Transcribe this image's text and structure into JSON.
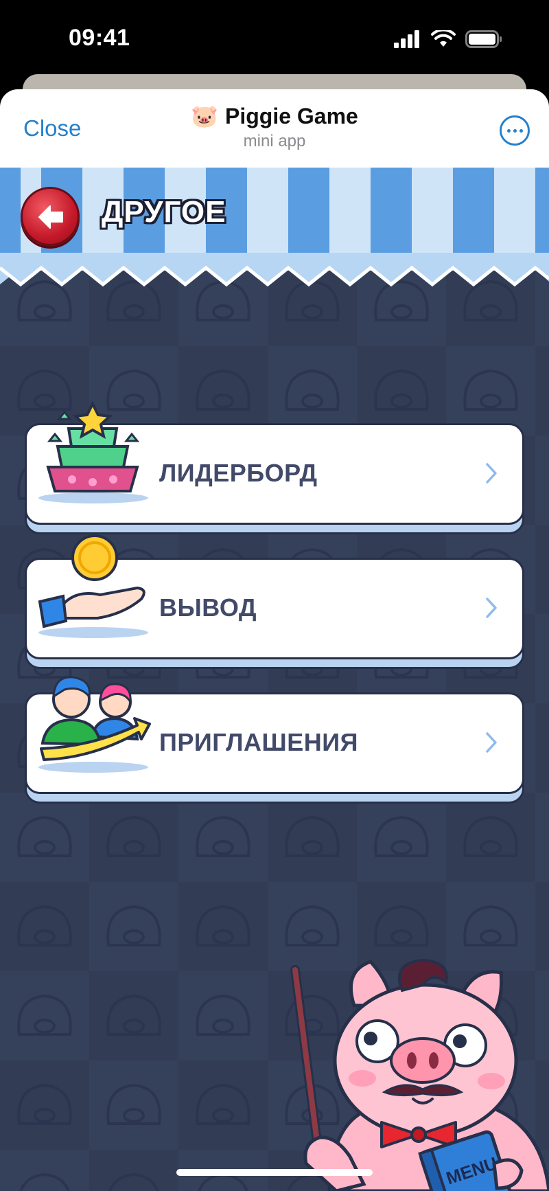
{
  "status_bar": {
    "time": "09:41"
  },
  "header": {
    "close_label": "Close",
    "app_emoji": "🐷",
    "title": "Piggie Game",
    "subtitle": "mini app",
    "more_icon": "ellipsis-circle-icon"
  },
  "screen": {
    "heading": "ДРУГОЕ",
    "back_icon": "arrow-left-icon"
  },
  "menu": [
    {
      "label": "ЛИДЕРБОРД",
      "icon": "trophy-podium-icon"
    },
    {
      "label": "ВЫВОД",
      "icon": "coin-hand-icon"
    },
    {
      "label": "ПРИГЛАШЕНИЯ",
      "icon": "friends-invite-icon"
    }
  ],
  "mascot": {
    "book_text": "MENU"
  },
  "colors": {
    "accent": "#2481cc",
    "background": "#35405a",
    "awning_dark": "#5a9de0",
    "awning_light": "#cfe4f7",
    "back_button": "#c4192a",
    "card_text": "#424a6a"
  }
}
